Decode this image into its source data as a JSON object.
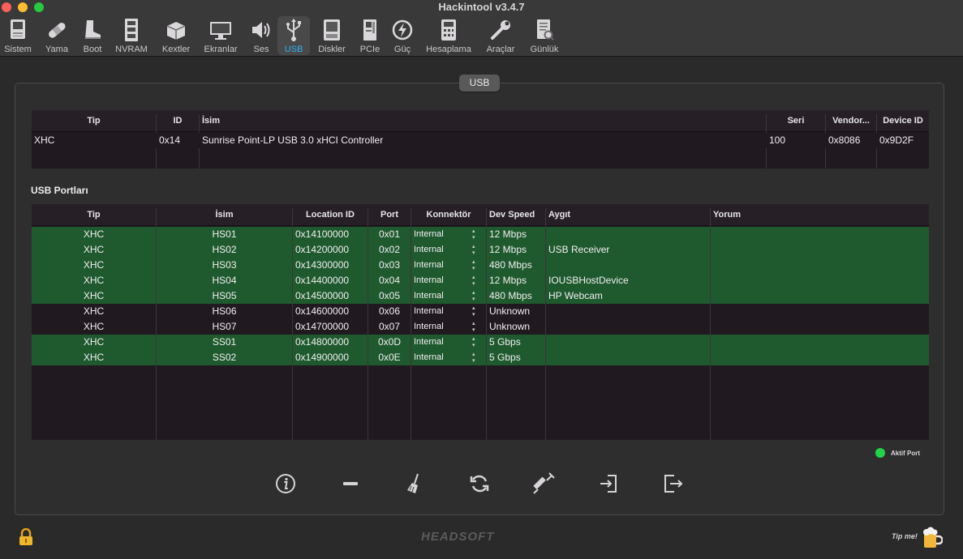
{
  "window": {
    "title": "Hackintool v3.4.7"
  },
  "toolbar": {
    "items": [
      {
        "label": "Sistem",
        "icon": "computer-icon"
      },
      {
        "label": "Yama",
        "icon": "bandage-icon"
      },
      {
        "label": "Boot",
        "icon": "boot-icon"
      },
      {
        "label": "NVRAM",
        "icon": "memory-icon"
      },
      {
        "label": "Kextler",
        "icon": "kext-box-icon"
      },
      {
        "label": "Ekranlar",
        "icon": "display-icon"
      },
      {
        "label": "Ses",
        "icon": "speaker-icon"
      },
      {
        "label": "USB",
        "icon": "usb-icon",
        "active": true
      },
      {
        "label": "Diskler",
        "icon": "disk-icon"
      },
      {
        "label": "PCIe",
        "icon": "pcie-card-icon"
      },
      {
        "label": "Güç",
        "icon": "power-icon"
      },
      {
        "label": "Hesaplama",
        "icon": "calculator-icon"
      },
      {
        "label": "Araçlar",
        "icon": "wrench-icon"
      },
      {
        "label": "Günlük",
        "icon": "log-icon"
      }
    ]
  },
  "group": {
    "label": "USB"
  },
  "controllers": {
    "headers": [
      "Tip",
      "ID",
      "İsim",
      "Seri",
      "Vendor...",
      "Device ID"
    ],
    "rows": [
      {
        "tip": "XHC",
        "id": "0x14",
        "isim": "Sunrise Point-LP USB 3.0 xHCI Controller",
        "seri": "100",
        "vendor": "0x8086",
        "device": "0x9D2F"
      }
    ]
  },
  "ports_section": {
    "title": "USB Portları"
  },
  "ports": {
    "headers": [
      "Tip",
      "İsim",
      "Location ID",
      "Port",
      "Konnektör",
      "Dev Speed",
      "Aygıt",
      "Yorum"
    ],
    "rows": [
      {
        "tip": "XHC",
        "isim": "HS01",
        "location": "0x14100000",
        "port": "0x01",
        "connector": "Internal",
        "speed": "12 Mbps",
        "device": "",
        "comment": "",
        "active": true
      },
      {
        "tip": "XHC",
        "isim": "HS02",
        "location": "0x14200000",
        "port": "0x02",
        "connector": "Internal",
        "speed": "12 Mbps",
        "device": "USB Receiver",
        "comment": "",
        "active": true
      },
      {
        "tip": "XHC",
        "isim": "HS03",
        "location": "0x14300000",
        "port": "0x03",
        "connector": "Internal",
        "speed": "480 Mbps",
        "device": "",
        "comment": "",
        "active": true
      },
      {
        "tip": "XHC",
        "isim": "HS04",
        "location": "0x14400000",
        "port": "0x04",
        "connector": "Internal",
        "speed": "12 Mbps",
        "device": "IOUSBHostDevice",
        "comment": "",
        "active": true
      },
      {
        "tip": "XHC",
        "isim": "HS05",
        "location": "0x14500000",
        "port": "0x05",
        "connector": "Internal",
        "speed": "480 Mbps",
        "device": "HP Webcam",
        "comment": "",
        "active": true
      },
      {
        "tip": "XHC",
        "isim": "HS06",
        "location": "0x14600000",
        "port": "0x06",
        "connector": "Internal",
        "speed": "Unknown",
        "device": "",
        "comment": "",
        "active": false
      },
      {
        "tip": "XHC",
        "isim": "HS07",
        "location": "0x14700000",
        "port": "0x07",
        "connector": "Internal",
        "speed": "Unknown",
        "device": "",
        "comment": "",
        "active": false
      },
      {
        "tip": "XHC",
        "isim": "SS01",
        "location": "0x14800000",
        "port": "0x0D",
        "connector": "Internal",
        "speed": "5 Gbps",
        "device": "",
        "comment": "",
        "active": true
      },
      {
        "tip": "XHC",
        "isim": "SS02",
        "location": "0x14900000",
        "port": "0x0E",
        "connector": "Internal",
        "speed": "5 Gbps",
        "device": "",
        "comment": "",
        "active": true
      }
    ]
  },
  "legend": {
    "label": "Aktif Port",
    "color": "#22d34a"
  },
  "colors": {
    "active_row": "#1f5a2e",
    "inactive_row": "#201a20",
    "accent": "#2fb0f2"
  },
  "footer": {
    "brand": "HEADSOFT",
    "tip": "Tip me!"
  }
}
